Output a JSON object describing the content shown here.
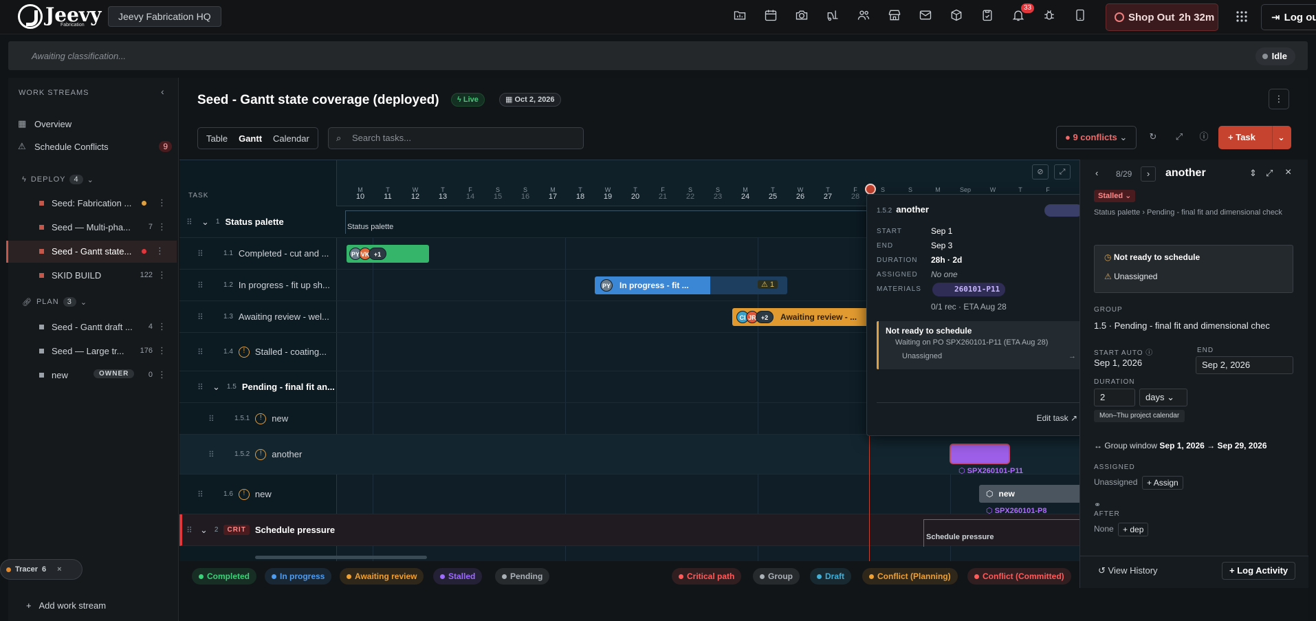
{
  "topbar": {
    "logo_text": "Jeevy",
    "logo_sub": "Fabrication",
    "workspace": "Jeevy Fabrication HQ",
    "notif_count": "33",
    "shop_label": "Shop Out",
    "shop_time": "2h 32m",
    "logout_label": "Log out",
    "icons": [
      "folder-chart-icon",
      "calendar-icon",
      "camera-icon",
      "forklift-icon",
      "users-icon",
      "store-icon",
      "mail-icon",
      "package-icon",
      "clipboard-check-icon",
      "bell-icon",
      "bug-icon",
      "tablet-icon"
    ]
  },
  "classbar": {
    "text": "Awaiting classification...",
    "status": "Idle"
  },
  "sidebar": {
    "header": "WORK STREAMS",
    "overview": "Overview",
    "schedule_conflicts": "Schedule Conflicts",
    "schedule_conflicts_count": "9",
    "deploy_label": "DEPLOY",
    "deploy_count": "4",
    "deploy_streams": [
      {
        "name": "Seed: Fabrication ...",
        "count": ""
      },
      {
        "name": "Seed — Multi-pha...",
        "count": "7"
      },
      {
        "name": "Seed - Gantt state...",
        "count": ""
      },
      {
        "name": "SKID BUILD",
        "count": "122"
      }
    ],
    "plan_label": "PLAN",
    "plan_count": "3",
    "plan_streams": [
      {
        "name": "Seed - Gantt draft ...",
        "count": "4"
      },
      {
        "name": "Seed — Large tr...",
        "count": "176"
      },
      {
        "name": "new",
        "count": "0",
        "badge": "OWNER"
      }
    ],
    "add_work_stream": "Add work stream",
    "tracer_label": "Tracer",
    "tracer_count": "6"
  },
  "page": {
    "title": "Seed - Gantt state coverage (deployed)",
    "live": "Live",
    "date": "Oct 2, 2026",
    "views": [
      "Table",
      "Gantt",
      "Calendar"
    ],
    "search_placeholder": "Search tasks...",
    "conflicts": "9 conflicts",
    "task_button": "Task"
  },
  "gantt": {
    "task_header": "TASK",
    "days": [
      {
        "w": "M",
        "d": "10"
      },
      {
        "w": "T",
        "d": "11"
      },
      {
        "w": "W",
        "d": "12"
      },
      {
        "w": "T",
        "d": "13"
      },
      {
        "w": "F",
        "d": "14"
      },
      {
        "w": "S",
        "d": "15"
      },
      {
        "w": "S",
        "d": "16"
      },
      {
        "w": "M",
        "d": "17"
      },
      {
        "w": "T",
        "d": "18"
      },
      {
        "w": "W",
        "d": "19"
      },
      {
        "w": "T",
        "d": "20"
      },
      {
        "w": "F",
        "d": "21"
      },
      {
        "w": "S",
        "d": "22"
      },
      {
        "w": "S",
        "d": "23"
      },
      {
        "w": "M",
        "d": "24"
      },
      {
        "w": "T",
        "d": "25"
      },
      {
        "w": "W",
        "d": "26"
      },
      {
        "w": "T",
        "d": "27"
      },
      {
        "w": "F",
        "d": "28"
      },
      {
        "w": "S",
        "d": ""
      },
      {
        "w": "S",
        "d": ""
      },
      {
        "w": "M",
        "d": ""
      },
      {
        "w": "Sep",
        "d": ""
      },
      {
        "w": "W",
        "d": ""
      },
      {
        "w": "T",
        "d": ""
      },
      {
        "w": "F",
        "d": ""
      }
    ],
    "rows": [
      {
        "wbs": "1",
        "name": "Status palette"
      },
      {
        "wbs": "1.1",
        "name": "Completed - cut and ..."
      },
      {
        "wbs": "1.2",
        "name": "In progress - fit up sh..."
      },
      {
        "wbs": "1.3",
        "name": "Awaiting review - wel..."
      },
      {
        "wbs": "1.4",
        "name": "Stalled - coating..."
      },
      {
        "wbs": "1.5",
        "name": "Pending - final fit an..."
      },
      {
        "wbs": "1.5.1",
        "name": "new"
      },
      {
        "wbs": "1.5.2",
        "name": "another"
      },
      {
        "wbs": "1.6",
        "name": "new"
      },
      {
        "wbs": "2",
        "name": "Schedule pressure",
        "tag": "CRIT"
      }
    ],
    "bars": {
      "status_palette_label": "Status palette",
      "completed_avatars": [
        "PY",
        "VK"
      ],
      "completed_more": "+1",
      "inprogress_avatar": "PY",
      "inprogress_label": "In progress - fit ...",
      "inprogress_warn": "1",
      "awaiting_avatars": [
        "CI",
        "JR"
      ],
      "awaiting_more": "+2",
      "awaiting_label": "Awaiting review - ...",
      "another_material": "SPX260101-P11",
      "new_label": "new",
      "new_material": "SPX260101-P8",
      "schedule_pressure_label": "Schedule pressure"
    }
  },
  "legend": {
    "items": [
      {
        "label": "Completed",
        "color": "#3ccf7a"
      },
      {
        "label": "In progress",
        "color": "#4e9cf0"
      },
      {
        "label": "Awaiting review",
        "color": "#f0a030"
      },
      {
        "label": "Stalled",
        "color": "#9d6bff"
      },
      {
        "label": "Pending",
        "color": "#aab2b8"
      },
      {
        "label": "Critical path",
        "color": "#ff5b5b"
      },
      {
        "label": "Group",
        "color": "#aab2b8"
      },
      {
        "label": "Draft",
        "color": "#40b0d8"
      },
      {
        "label": "Conflict (Planning)",
        "color": "#f0a030"
      },
      {
        "label": "Conflict (Committed)",
        "color": "#ff5b5b"
      }
    ]
  },
  "popover": {
    "wbs": "1.5.2",
    "name": "another",
    "start_k": "START",
    "start_v": "Sep 1",
    "end_k": "END",
    "end_v": "Sep 3",
    "duration_k": "DURATION",
    "duration_v": "28h",
    "duration_days": "2d",
    "assigned_k": "ASSIGNED",
    "assigned_v": "No one",
    "materials_k": "MATERIALS",
    "material_chip": "260101-P11",
    "materials_eta": "0/1 rec · ETA Aug 28",
    "warn_title": "Not ready to schedule",
    "warn_line1": "Waiting on PO SPX260101-P11 (ETA Aug 28)",
    "warn_line2": "Unassigned",
    "edit_task": "Edit task"
  },
  "panel": {
    "pager": "8/29",
    "title": "another",
    "status": "Stalled",
    "breadcrumb": "Status palette › Pending - final fit and dimensional check",
    "warn_title": "Not ready to schedule",
    "warn_unassigned": "Unassigned",
    "group_label": "GROUP",
    "group_value": "1.5 · Pending - final fit and dimensional chec",
    "start_label": "START",
    "start_auto": "AUTO",
    "start_value": "Sep 1, 2026",
    "end_label": "END",
    "end_value": "Sep 2, 2026",
    "duration_label": "DURATION",
    "duration_value": "2",
    "duration_unit": "days",
    "calendar_chip": "Mon–Thu project calendar",
    "group_window_label": "Group window",
    "group_window_value": "Sep 1, 2026 → Sep 29, 2026",
    "assigned_label": "ASSIGNED",
    "assigned_value": "Unassigned",
    "assign_button": "Assign",
    "after_label": "AFTER",
    "after_value": "None",
    "dep_button": "dep",
    "view_history": "View History",
    "log_activity": "Log Activity"
  }
}
